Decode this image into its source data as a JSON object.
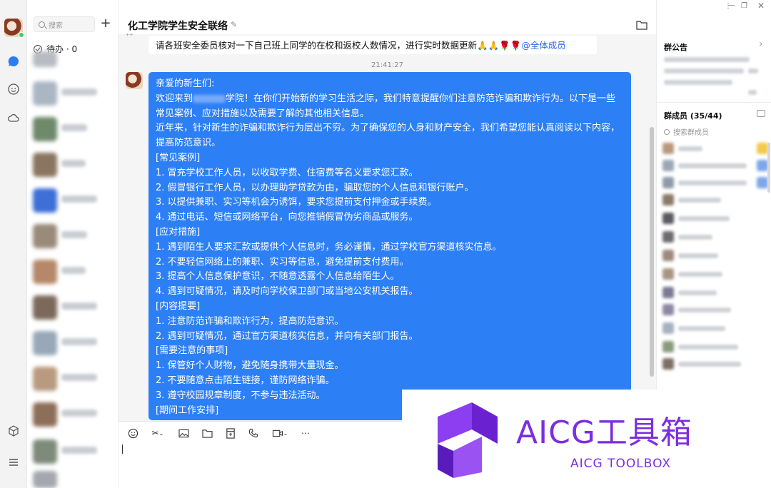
{
  "sidebar": {
    "search_placeholder": "搜索",
    "todo_label": "待办 · 0"
  },
  "chat": {
    "title": "化工学院学生安全联络",
    "pinned_message": "请各班安全委员核对一下自己班上同学的在校和返校人数情况，进行实时数据更新",
    "pinned_emojis": "🙏🙏🌹🌹",
    "pinned_mention": "@全体成员",
    "timestamp": "21:41:27",
    "message": {
      "greeting": "亲爱的新生们:",
      "intro_before": "欢迎来到",
      "intro_after": "学院！在你们开始新的学习生活之际，我们特意提醒你们注意防范诈骗和欺诈行为。以下是一些常见案例、应对措施以及需要了解的其他相关信息。",
      "para2": "近年来，针对新生的诈骗和欺诈行为层出不穷。为了确保您的人身和财产安全，我们希望您能认真阅读以下内容，提高防范意识。",
      "section1": "[常见案例]",
      "s1_1": "1. 冒充学校工作人员，以收取学费、住宿费等名义要求您汇款。",
      "s1_2": "2. 假冒银行工作人员，以办理助学贷款为由，骗取您的个人信息和银行账户。",
      "s1_3": "3. 以提供兼职、实习等机会为诱饵，要求您提前支付押金或手续费。",
      "s1_4": "4. 通过电话、短信或网络平台，向您推销假冒伪劣商品或服务。",
      "section2": "[应对措施]",
      "s2_1": "1. 遇到陌生人要求汇款或提供个人信息时，务必谨慎，通过学校官方渠道核实信息。",
      "s2_2": "2. 不要轻信网络上的兼职、实习等信息，避免提前支付费用。",
      "s2_3": "3. 提高个人信息保护意识，不随意透露个人信息给陌生人。",
      "s2_4": "4. 遇到可疑情况，请及时向学校保卫部门或当地公安机关报告。",
      "section3": "[内容提要]",
      "s3_1": "1. 注意防范诈骗和欺诈行为，提高防范意识。",
      "s3_2": "2. 遇到可疑情况，通过官方渠道核实信息，并向有关部门报告。",
      "section4": "[需要注意的事项]",
      "s4_1": "1. 保管好个人财物，避免随身携带大量现金。",
      "s4_2": "2. 不要随意点击陌生链接，谨防网络诈骗。",
      "s4_3": "3. 遵守校园规章制度，不参与违法活动。",
      "section5": "[期间工作安排]"
    }
  },
  "right_panel": {
    "notice_title": "群公告",
    "members_title": "群成员 (35/44)",
    "member_search_placeholder": "搜索群成员"
  },
  "watermark": {
    "title": "AICG工具箱",
    "subtitle": "AICG TOOLBOX"
  },
  "colors": {
    "bubble": "#2d7ff5",
    "accent": "#2b6be8",
    "watermark": "#7b2ee0"
  }
}
